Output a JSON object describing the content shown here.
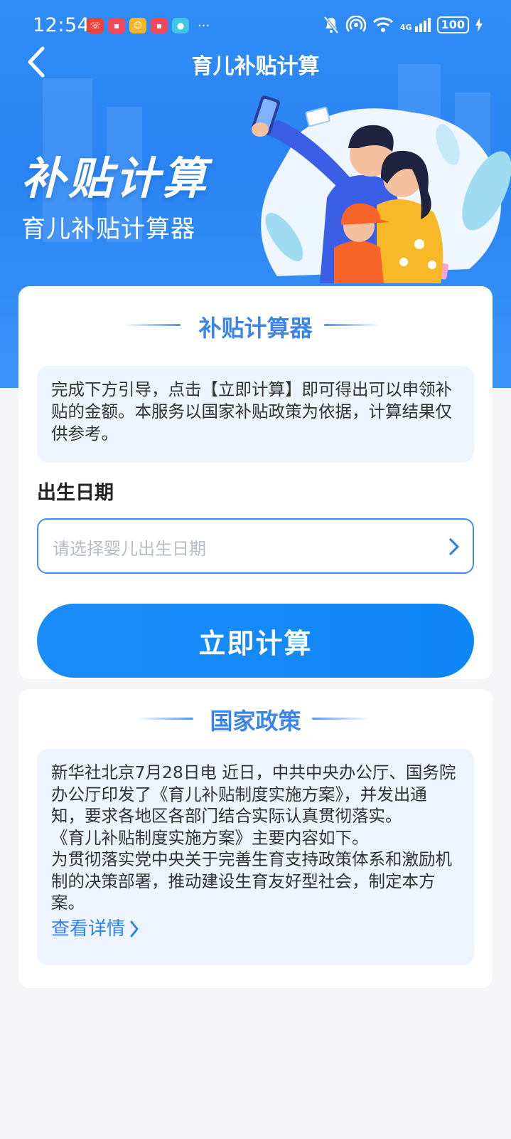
{
  "status_bar": {
    "time": "12:54",
    "more": "···",
    "network": "4G",
    "battery": "100"
  },
  "header": {
    "title": "育儿补贴计算"
  },
  "hero": {
    "title": "补贴计算",
    "subtitle": "育儿补贴计算器"
  },
  "calculator": {
    "section_title": "补贴计算器",
    "intro": "完成下方引导，点击【立即计算】即可得出可以申领补贴的金额。本服务以国家补贴政策为依据，计算结果仅供参考。",
    "birth_date_label": "出生日期",
    "birth_date_value": "",
    "birth_date_placeholder": "请选择婴儿出生日期",
    "calculate_button": "立即计算"
  },
  "policy": {
    "section_title": "国家政策",
    "paragraphs": [
      "新华社北京7月28日电 近日，中共中央办公厅、国务院办公厅印发了《育儿补贴制度实施方案》，并发出通知，要求各地区各部门结合实际认真贯彻落实。",
      "《育儿补贴制度实施方案》主要内容如下。",
      "为贯彻落实党中央关于完善生育支持政策体系和激励机制的决策部署，推动建设生育友好型社会，制定本方案。"
    ],
    "detail_link": "查看详情"
  },
  "colors": {
    "primary": "#1a8cf9",
    "header_blue": "#2f8cf7",
    "section_title": "#3b85ea",
    "info_bg": "#eef4fd",
    "page_bg": "#f5f5f7"
  }
}
